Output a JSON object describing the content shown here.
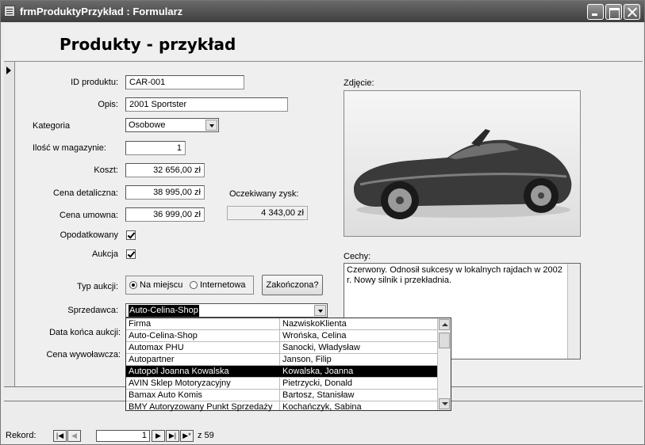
{
  "window": {
    "title": "frmProduktyPrzykład : Formularz"
  },
  "header": {
    "title": "Produkty - przykład"
  },
  "fields": {
    "id_label": "ID produktu:",
    "id_value": "CAR-001",
    "opis_label": "Opis:",
    "opis_value": "2001 Sportster",
    "kategoria_label": "Kategoria",
    "kategoria_value": "Osobowe",
    "ilosc_label": "Ilość w magazynie:",
    "ilosc_value": "1",
    "koszt_label": "Koszt:",
    "koszt_value": "32 656,00 zł",
    "cena_det_label": "Cena detaliczna:",
    "cena_det_value": "38 995,00 zł",
    "cena_um_label": "Cena umowna:",
    "cena_um_value": "36 999,00 zł",
    "zysk_label": "Oczekiwany zysk:",
    "zysk_value": "4 343,00 zł",
    "opodatkowany_label": "Opodatkowany",
    "opodatkowany_checked": true,
    "aukcja_label": "Aukcja",
    "aukcja_checked": true,
    "typ_aukcji_label": "Typ aukcji:",
    "typ_option1": "Na miejscu",
    "typ_option2": "Internetowa",
    "typ_selected": "Na miejscu",
    "zakonczona_button": "Zakończona?",
    "sprzedawca_label": "Sprzedawca:",
    "sprzedawca_value": "Auto-Celina-Shop",
    "data_konca_label": "Data końca aukcji:",
    "cena_wywolawcza_label": "Cena wywoławcza:",
    "zdjecie_label": "Zdjęcie:",
    "cechy_label": "Cechy:",
    "cechy_value": "Czerwony. Odnosił sukcesy w lokalnych rajdach w 2002 r. Nowy silnik i przekładnia."
  },
  "dropdown": {
    "headers": [
      "Firma",
      "NazwiskoKlienta"
    ],
    "rows": [
      [
        "Auto-Celina-Shop",
        "Wrońska, Celina"
      ],
      [
        "Automax PHU",
        "Sanocki, Władysław"
      ],
      [
        "Autopartner",
        "Janson, Filip"
      ],
      [
        "Autopol Joanna Kowalska",
        "Kowalska, Joanna"
      ],
      [
        "AVIN Sklep Motoryzacyjny",
        "Pietrzycki, Donald"
      ],
      [
        "Bamax Auto Komis",
        "Bartosz, Stanisław"
      ],
      [
        "BMY Autoryzowany Punkt Sprzedaży",
        "Kochańczyk, Sabina"
      ]
    ],
    "selected_index": 3
  },
  "navigation": {
    "label": "Rekord:",
    "current": "1",
    "total_text": "z 59"
  }
}
